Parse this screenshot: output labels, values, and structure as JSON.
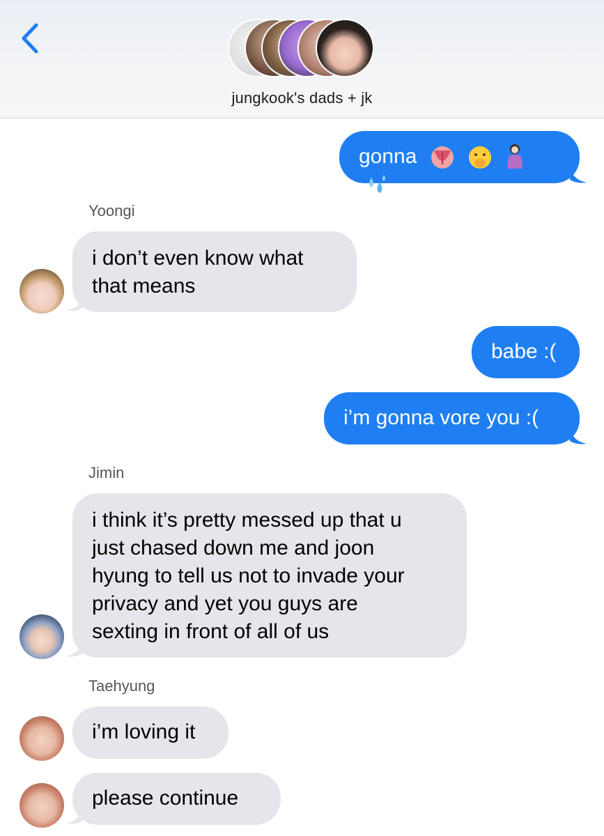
{
  "header": {
    "back_icon": "chevron-left-icon",
    "title": "jungkook's dads + jk",
    "group_avatars": [
      "member-1",
      "member-2",
      "member-3",
      "member-4",
      "member-5",
      "jungkook"
    ]
  },
  "messages": [
    {
      "direction": "outgoing",
      "text": "gonna",
      "emojis": [
        "tongue-emoji",
        "shushing-face-emoji",
        "pregnant-woman-emoji",
        "sweat-droplets-emoji"
      ]
    },
    {
      "direction": "incoming",
      "sender": "Yoongi",
      "lines": [
        "i don’t even know what",
        "that means"
      ]
    },
    {
      "direction": "outgoing",
      "text": "babe :("
    },
    {
      "direction": "outgoing",
      "text": "i’m gonna vore you :("
    },
    {
      "direction": "incoming",
      "sender": "Jimin",
      "lines": [
        "i think it’s pretty messed up that u",
        "just chased down me and joon",
        "hyung to tell us not to invade your",
        "privacy and yet you guys are",
        "sexting in front of all of us"
      ]
    },
    {
      "direction": "incoming",
      "sender": "Taehyung",
      "lines": [
        "i’m loving it"
      ]
    },
    {
      "direction": "incoming",
      "sender": "",
      "lines": [
        "please continue"
      ]
    }
  ],
  "colors": {
    "outgoing_bubble": "#1f7ff2",
    "incoming_bubble": "#e6e5eb",
    "accent": "#1f7ff2"
  }
}
